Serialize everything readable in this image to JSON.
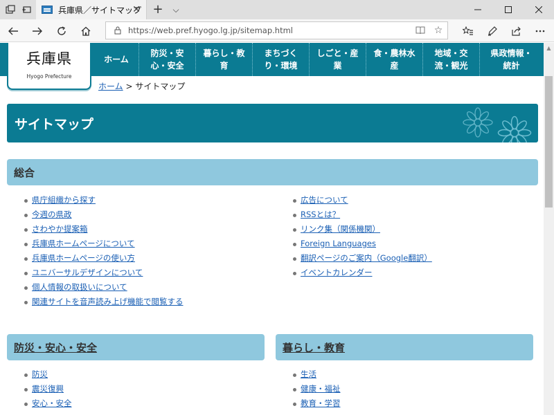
{
  "browser": {
    "tab_title": "兵庫県／サイトマップ",
    "url": "https://web.pref.hyogo.lg.jp/sitemap.html"
  },
  "site": {
    "logo_main": "兵庫県",
    "logo_sub": "Hyogo Prefecture",
    "gnav": [
      {
        "l1": "ホーム",
        "l2": ""
      },
      {
        "l1": "防災・安",
        "l2": "心・安全"
      },
      {
        "l1": "暮らし・教",
        "l2": "育"
      },
      {
        "l1": "まちづく",
        "l2": "り・環境"
      },
      {
        "l1": "しごと・産",
        "l2": "業"
      },
      {
        "l1": "食・農林水",
        "l2": "産"
      },
      {
        "l1": "地域・交",
        "l2": "流・観光"
      },
      {
        "l1": "県政情報・",
        "l2": "統計"
      }
    ],
    "breadcrumb_home": "ホーム",
    "breadcrumb_sep": ">",
    "breadcrumb_current": "サイトマップ"
  },
  "page": {
    "title": "サイトマップ"
  },
  "sections": {
    "general": {
      "heading": "総合",
      "left": [
        "県庁組織から探す",
        "今週の県政",
        "さわやか提案箱",
        "兵庫県ホームページについて",
        "兵庫県ホームページの使い方",
        "ユニバーサルデザインについて",
        "個人情報の取扱いについて",
        "関連サイトを音声読み上げ機能で閲覧する"
      ],
      "right": [
        "広告について",
        "RSSとは？",
        "リンク集（関係機関）",
        "Foreign Languages",
        "翻訳ページのご案内（Google翻訳）",
        "イベントカレンダー"
      ]
    },
    "safety": {
      "heading": "防災・安心・安全",
      "items": [
        "防災",
        "震災復興",
        "安心・安全"
      ]
    },
    "living": {
      "heading": "暮らし・教育",
      "items": [
        "生活",
        "健康・福祉",
        "教育・学習"
      ]
    }
  },
  "colors": {
    "brand": "#0b7b93",
    "section_bg": "#8fc8de",
    "link": "#1a5fb4"
  }
}
